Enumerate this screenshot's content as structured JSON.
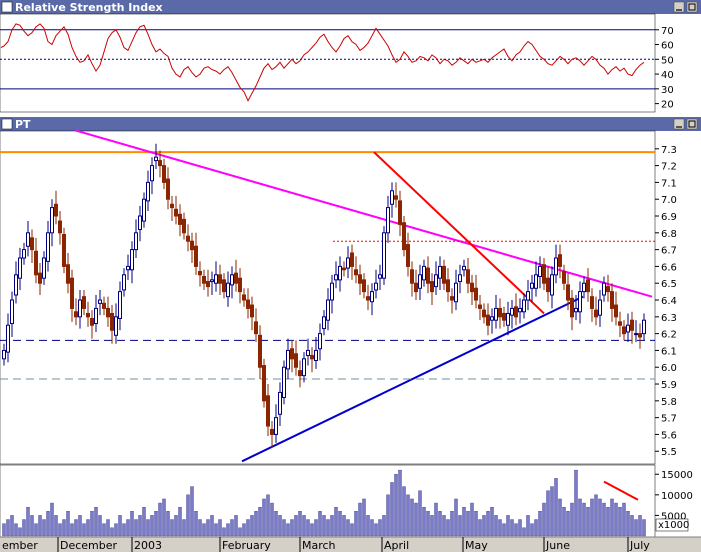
{
  "chart_data": [
    {
      "type": "line",
      "title": "Relative Strength Index",
      "ylim": [
        15,
        80
      ],
      "yticks": [
        20,
        30,
        40,
        50,
        60,
        70
      ],
      "reference_lines": [
        30,
        50,
        70
      ],
      "colors": {
        "line": "#cc0000",
        "reference": "#000080"
      },
      "x": [
        1,
        4,
        8,
        12,
        16,
        20,
        24,
        28,
        32,
        36,
        40,
        44,
        48,
        52,
        56,
        60,
        64,
        68,
        72,
        76,
        80,
        84,
        88,
        92,
        96,
        100,
        104,
        108,
        112,
        116,
        120,
        124,
        128,
        132,
        136,
        140,
        144,
        148,
        152,
        156,
        160,
        164,
        168,
        172,
        176,
        180,
        184,
        188,
        192,
        196,
        200,
        204,
        208,
        212,
        216,
        220,
        224,
        228,
        232,
        236,
        240,
        244,
        248,
        252,
        256,
        260,
        264,
        268,
        272,
        276,
        280,
        284,
        288,
        292,
        296,
        300,
        304,
        308,
        312,
        316,
        320,
        324,
        328,
        332,
        336,
        340,
        344,
        348,
        352,
        356,
        360,
        364,
        368,
        372,
        376,
        380,
        384,
        388,
        392,
        396,
        400,
        404,
        408,
        412,
        416,
        420,
        424,
        428,
        432,
        436,
        440,
        444,
        448,
        452,
        456,
        460,
        464,
        468,
        472,
        476,
        480,
        484,
        488,
        492,
        496,
        500,
        504,
        508,
        512,
        516,
        520,
        524,
        528,
        532,
        536,
        540,
        544,
        548,
        552,
        556,
        560,
        564,
        568,
        572,
        576,
        580,
        584,
        588,
        592,
        596,
        600,
        604,
        608,
        612,
        616,
        620,
        624,
        628,
        632,
        636,
        640,
        644
      ],
      "values": [
        58,
        59,
        62,
        70,
        74,
        73,
        69,
        66,
        68,
        72,
        74,
        71,
        62,
        60,
        66,
        69,
        72,
        67,
        58,
        52,
        48,
        49,
        53,
        47,
        42,
        46,
        55,
        64,
        68,
        70,
        65,
        58,
        56,
        62,
        68,
        72,
        73,
        67,
        60,
        55,
        57,
        54,
        52,
        44,
        40,
        38,
        43,
        45,
        41,
        38,
        40,
        44,
        45,
        43,
        42,
        40,
        43,
        45,
        41,
        36,
        31,
        28,
        22,
        27,
        32,
        38,
        44,
        47,
        43,
        45,
        48,
        44,
        47,
        50,
        47,
        49,
        53,
        55,
        58,
        61,
        65,
        67,
        62,
        58,
        55,
        59,
        64,
        66,
        62,
        60,
        56,
        58,
        61,
        66,
        71,
        67,
        63,
        59,
        53,
        48,
        50,
        55,
        52,
        48,
        49,
        52,
        51,
        49,
        53,
        51,
        47,
        50,
        49,
        46,
        48,
        51,
        49,
        47,
        50,
        48,
        49,
        50,
        48,
        51,
        53,
        55,
        57,
        52,
        49,
        53,
        55,
        59,
        62,
        60,
        56,
        52,
        50,
        47,
        46,
        49,
        52,
        50,
        47,
        50,
        51,
        49,
        46,
        49,
        52,
        50,
        46,
        44,
        40,
        43,
        45,
        42,
        44,
        40,
        39,
        43,
        46,
        48
      ]
    },
    {
      "type": "candlestick",
      "title": "PT",
      "ylim": [
        5.43,
        7.4
      ],
      "yticks": [
        5.5,
        5.6,
        5.7,
        5.8,
        5.9,
        6.0,
        6.1,
        6.2,
        6.3,
        6.4,
        6.5,
        6.6,
        6.7,
        6.8,
        6.9,
        7.0,
        7.1,
        7.2,
        7.3
      ],
      "x_labels": [
        "ember",
        "December",
        "2003",
        "February",
        "March",
        "April",
        "May",
        "June",
        "July"
      ],
      "colors": {
        "up": "#000080",
        "down": "#8b2500",
        "orange_line": "#ff8c00",
        "magenta_line": "#ff00ff",
        "red_line": "#ff0000",
        "blue_line": "#0000cd",
        "dashed": "#000080",
        "dashed_light": "#7090a0",
        "red_dotted": "#ff0000"
      },
      "trendlines": [
        {
          "name": "resistance-horizontal",
          "color": "#ff8c00",
          "style": "solid",
          "from": [
            0,
            7.28
          ],
          "to": [
            655,
            7.28
          ]
        },
        {
          "name": "down-trendline",
          "color": "#ff00ff",
          "style": "solid",
          "from": [
            75,
            7.41
          ],
          "to": [
            652,
            6.42
          ]
        },
        {
          "name": "short-downtrend",
          "color": "#ff0000",
          "style": "solid",
          "from": [
            374,
            7.28
          ],
          "to": [
            544,
            6.32
          ]
        },
        {
          "name": "up-trendline",
          "color": "#0000cd",
          "style": "solid",
          "from": [
            242,
            5.44
          ],
          "to": [
            583,
            6.42
          ]
        },
        {
          "name": "support-dashed",
          "color": "#000080",
          "style": "dashed",
          "from": [
            0,
            6.16
          ],
          "to": [
            655,
            6.16
          ]
        },
        {
          "name": "lower-dashed",
          "color": "#7090a0",
          "style": "dashed",
          "from": [
            0,
            5.93
          ],
          "to": [
            655,
            5.93
          ]
        },
        {
          "name": "upper-dotted",
          "color": "#ff0000",
          "style": "dotted",
          "from": [
            333,
            6.75
          ],
          "to": [
            655,
            6.75
          ]
        }
      ],
      "x": [
        4,
        8,
        12,
        16,
        20,
        24,
        28,
        32,
        36,
        40,
        44,
        48,
        52,
        56,
        60,
        64,
        68,
        72,
        76,
        80,
        84,
        88,
        92,
        96,
        100,
        104,
        108,
        112,
        116,
        120,
        124,
        128,
        132,
        136,
        140,
        144,
        148,
        152,
        156,
        160,
        164,
        168,
        172,
        176,
        180,
        184,
        188,
        192,
        196,
        200,
        204,
        208,
        212,
        216,
        220,
        224,
        228,
        232,
        236,
        240,
        244,
        248,
        252,
        256,
        260,
        264,
        268,
        272,
        276,
        280,
        284,
        288,
        292,
        296,
        300,
        304,
        308,
        312,
        316,
        320,
        324,
        328,
        332,
        336,
        340,
        344,
        348,
        352,
        356,
        360,
        364,
        368,
        372,
        376,
        380,
        384,
        388,
        392,
        396,
        400,
        404,
        408,
        412,
        416,
        420,
        424,
        428,
        432,
        436,
        440,
        444,
        448,
        452,
        456,
        460,
        464,
        468,
        472,
        476,
        480,
        484,
        488,
        492,
        496,
        500,
        504,
        508,
        512,
        516,
        520,
        524,
        528,
        532,
        536,
        540,
        544,
        548,
        552,
        556,
        560,
        564,
        568,
        572,
        576,
        580,
        584,
        588,
        592,
        596,
        600,
        604,
        608,
        612,
        616,
        620,
        624,
        628,
        632,
        636,
        640,
        644
      ],
      "close": [
        6.1,
        6.25,
        6.4,
        6.55,
        6.65,
        6.7,
        6.8,
        6.7,
        6.55,
        6.5,
        6.65,
        6.8,
        6.95,
        6.9,
        6.8,
        6.6,
        6.5,
        6.35,
        6.3,
        6.4,
        6.35,
        6.3,
        6.25,
        6.35,
        6.4,
        6.35,
        6.3,
        6.22,
        6.3,
        6.45,
        6.55,
        6.6,
        6.7,
        6.8,
        6.9,
        7.0,
        7.1,
        7.2,
        7.25,
        7.2,
        7.1,
        7.0,
        6.95,
        6.9,
        6.85,
        6.8,
        6.75,
        6.7,
        6.6,
        6.55,
        6.5,
        6.48,
        6.52,
        6.55,
        6.5,
        6.45,
        6.5,
        6.55,
        6.5,
        6.45,
        6.4,
        6.35,
        6.3,
        6.2,
        6.0,
        5.8,
        5.65,
        5.6,
        5.7,
        5.85,
        6.0,
        6.1,
        6.05,
        6.0,
        5.95,
        6.05,
        6.1,
        6.05,
        6.1,
        6.2,
        6.3,
        6.4,
        6.5,
        6.55,
        6.6,
        6.58,
        6.65,
        6.6,
        6.55,
        6.5,
        6.45,
        6.4,
        6.45,
        6.5,
        6.55,
        6.8,
        6.95,
        7.05,
        7.0,
        6.85,
        6.7,
        6.6,
        6.5,
        6.45,
        6.55,
        6.6,
        6.5,
        6.45,
        6.55,
        6.6,
        6.5,
        6.45,
        6.4,
        6.5,
        6.55,
        6.6,
        6.5,
        6.45,
        6.4,
        6.35,
        6.3,
        6.25,
        6.3,
        6.35,
        6.3,
        6.28,
        6.32,
        6.35,
        6.3,
        6.35,
        6.4,
        6.45,
        6.5,
        6.55,
        6.6,
        6.5,
        6.45,
        6.55,
        6.65,
        6.6,
        6.5,
        6.4,
        6.3,
        6.35,
        6.45,
        6.5,
        6.45,
        6.35,
        6.3,
        6.4,
        6.5,
        6.45,
        6.35,
        6.3,
        6.25,
        6.2,
        6.25,
        6.22,
        6.2,
        6.18,
        6.28
      ]
    },
    {
      "type": "bar",
      "title": "",
      "ylim": [
        0,
        17000
      ],
      "yticks_labels": [
        "5000",
        "10000",
        "15000"
      ],
      "yticks_values": [
        5000,
        10000,
        15000
      ],
      "unit_label": "x1000",
      "annotation": {
        "name": "volume-declining-arrow",
        "color": "#ff0000",
        "from": [
          604,
          13200
        ],
        "to": [
          638,
          8800
        ]
      },
      "colors": {
        "bar": "#7b7bc8",
        "bar_edge": "#3c3c8c"
      },
      "values": [
        3000,
        4000,
        5000,
        3000,
        2000,
        4000,
        7000,
        5000,
        3000,
        5000,
        4000,
        6000,
        8000,
        5000,
        3000,
        4000,
        6000,
        3000,
        4000,
        5000,
        3000,
        4000,
        6000,
        7000,
        5000,
        3000,
        4000,
        2000,
        3000,
        5000,
        3000,
        4000,
        6000,
        4000,
        5000,
        7000,
        4000,
        5000,
        6000,
        8000,
        9000,
        6000,
        4000,
        5000,
        7000,
        4000,
        10000,
        12000,
        6000,
        4000,
        3000,
        4000,
        5000,
        3000,
        4000,
        2000,
        3000,
        4000,
        5000,
        2000,
        3000,
        4000,
        5000,
        6000,
        7000,
        9000,
        10000,
        8000,
        6000,
        5000,
        4000,
        3000,
        4000,
        5000,
        6000,
        5000,
        4000,
        3000,
        4000,
        6000,
        5000,
        4000,
        5000,
        7000,
        6000,
        5000,
        4000,
        3000,
        6000,
        8000,
        9000,
        5000,
        4000,
        3000,
        4000,
        5000,
        10000,
        13000,
        15000,
        16000,
        12000,
        10000,
        9000,
        8000,
        11000,
        7000,
        6000,
        5000,
        8000,
        6000,
        5000,
        4000,
        6000,
        9000,
        5000,
        7000,
        6000,
        8000,
        6000,
        4000,
        5000,
        6000,
        7000,
        5000,
        4000,
        3000,
        5000,
        4000,
        3000,
        4000,
        2000,
        5000,
        3000,
        4000,
        6000,
        8000,
        11000,
        12000,
        14000,
        9000,
        7000,
        6000,
        8000,
        16000,
        9000,
        8000,
        7000,
        9000,
        10000,
        9000,
        8000,
        7000,
        9000,
        8000,
        7000,
        8000,
        6000,
        5000,
        4000,
        5000,
        4000
      ]
    }
  ]
}
